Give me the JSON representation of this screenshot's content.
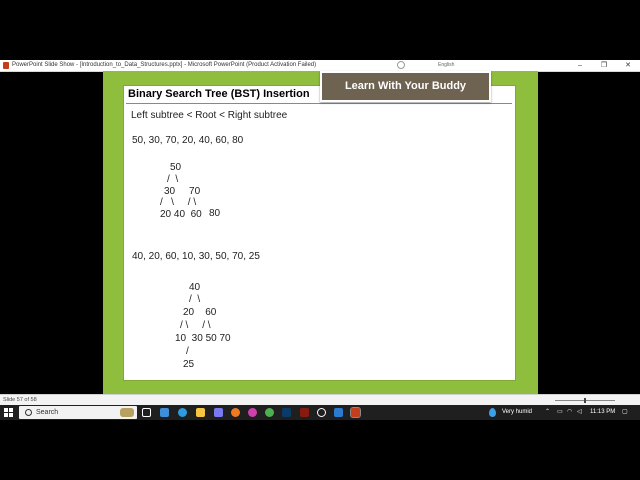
{
  "window": {
    "title": "PowerPoint Slide Show - [Introduction_to_Data_Structures.pptx] - Microsoft PowerPoint (Product Activation Failed)",
    "language": "English",
    "controls": [
      "–",
      "❐",
      "✕"
    ]
  },
  "slide": {
    "title": "Binary Search Tree (BST) Insertion",
    "banner": "Learn With Your Buddy",
    "rule": "Left subtree < Root < Right subtree",
    "sequence1": "50, 30, 70, 20, 40, 60, 80",
    "tree1": {
      "root": "50",
      "branch1": "/  \\",
      "level2": "30     70",
      "branch2": "/   \\     / \\",
      "level3a": "20 40  60",
      "level3b": "80"
    },
    "sequence2": "40, 20, 60, 10, 30, 50, 70, 25",
    "tree2": {
      "root": "40",
      "branch1": "/  \\",
      "level2": "20    60",
      "branch2": "/ \\     / \\",
      "level3": "10  30 50 70",
      "branch3": "/",
      "level4": "25"
    }
  },
  "statusbar": {
    "slide_number": "Slide 57 of 58"
  },
  "taskbar": {
    "search_label": "Search",
    "weather": "Very humid",
    "time": "11:13 PM"
  },
  "colors": {
    "slide_green": "#8fbe3e",
    "banner_brown": "#6e6250",
    "taskbar": "#1f1f1f"
  }
}
